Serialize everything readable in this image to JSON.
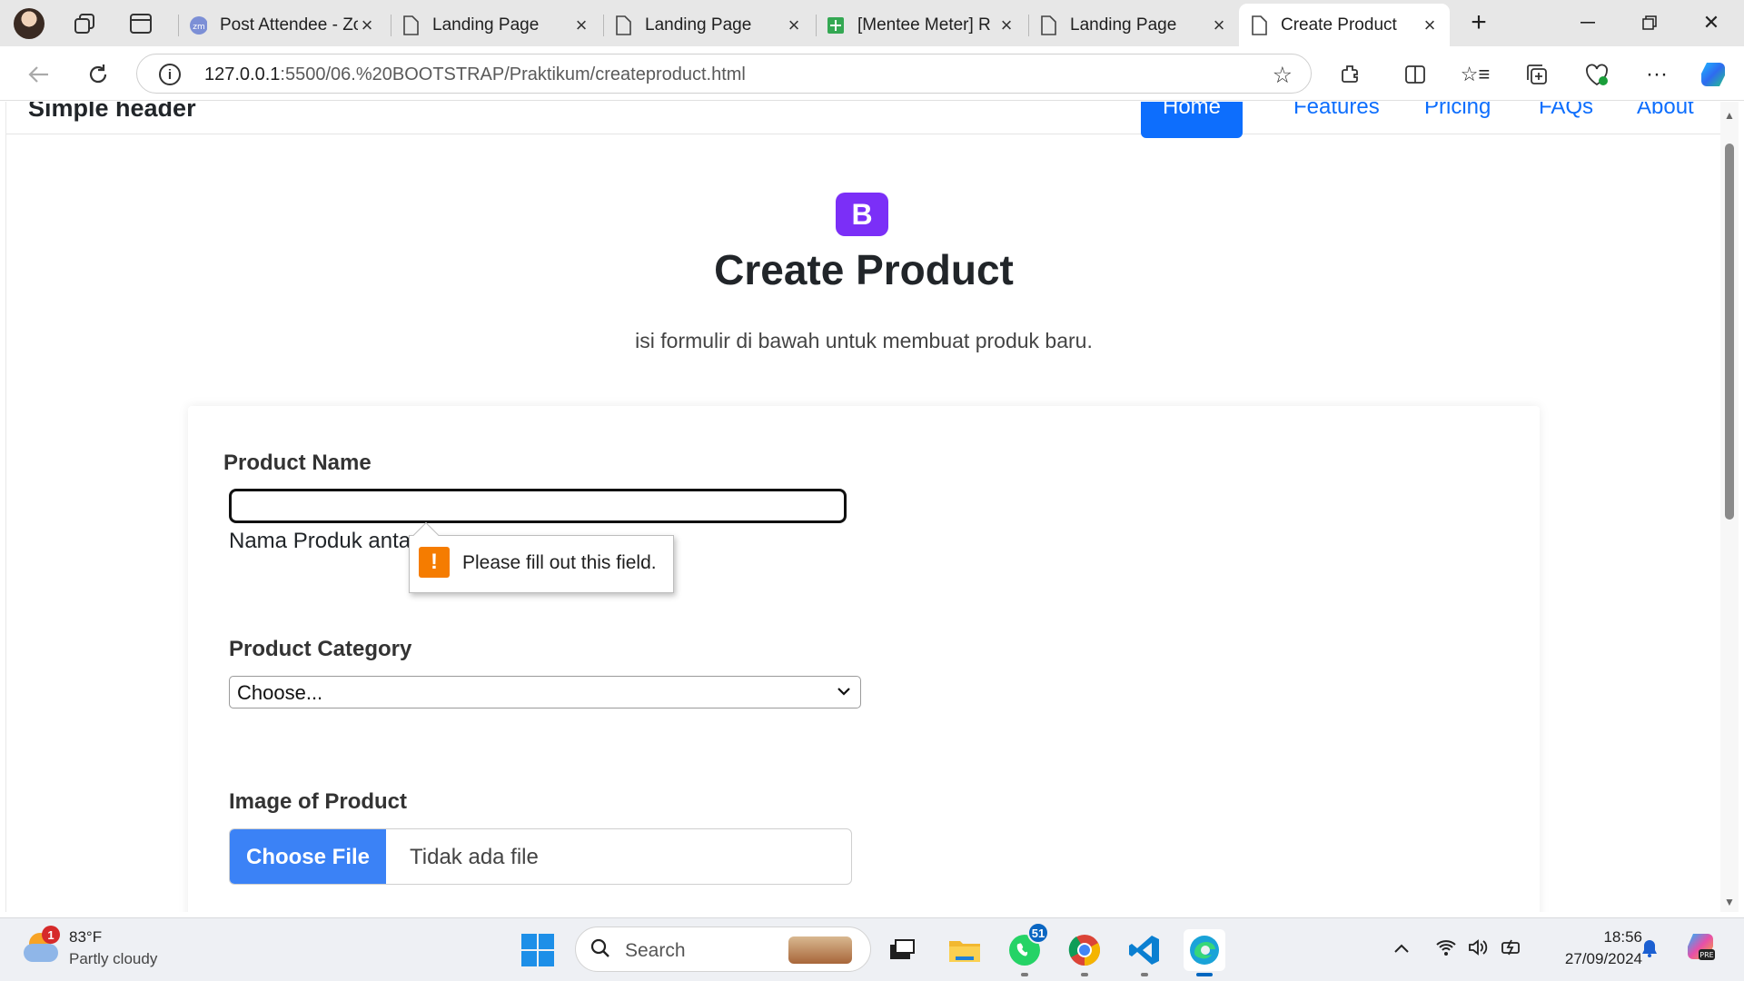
{
  "browser": {
    "tabs": [
      {
        "title": "Post Attendee - Zoom",
        "icon": "zoom-icon"
      },
      {
        "title": "Landing Page",
        "icon": "page-icon"
      },
      {
        "title": "Landing Page",
        "icon": "page-icon"
      },
      {
        "title": "[Mentee Meter] R",
        "icon": "sheets-icon"
      },
      {
        "title": "Landing Page",
        "icon": "page-icon"
      },
      {
        "title": "Create Product",
        "icon": "page-icon",
        "active": true
      }
    ],
    "url_host": "127.0.0.1",
    "url_rest": ":5500/06.%20BOOTSTRAP/Praktikum/createproduct.html"
  },
  "site": {
    "brand": "Simple header",
    "nav": [
      "Home",
      "Features",
      "Pricing",
      "FAQs",
      "About"
    ],
    "logo_letter": "B",
    "title": "Create Product",
    "lead": "isi formulir di bawah untuk membuat produk baru."
  },
  "form": {
    "product_name_label": "Product Name",
    "product_name_value": "",
    "product_name_help": "Nama Produk anta",
    "tooltip": "Please fill out this field.",
    "category_label": "Product Category",
    "category_value": "Choose...",
    "image_label": "Image of Product",
    "file_button": "Choose File",
    "file_name": "Tidak ada file"
  },
  "taskbar": {
    "weather_temp": "83°F",
    "weather_cond": "Partly cloudy",
    "weather_badge": "1",
    "search_placeholder": "Search",
    "whatsapp_badge": "51",
    "time": "18:56",
    "date": "27/09/2024"
  },
  "colors": {
    "primary": "#0d6efd",
    "bootstrap_purple": "#7b2ff7",
    "warning": "#f57c00"
  }
}
